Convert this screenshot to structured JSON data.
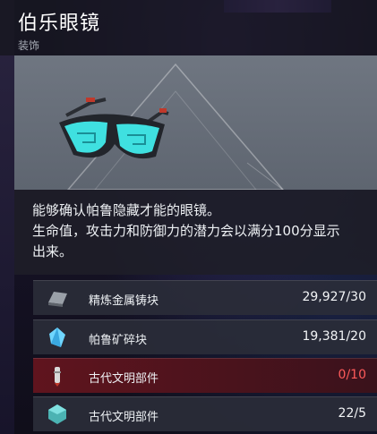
{
  "item": {
    "name": "伯乐眼镜",
    "category": "装饰"
  },
  "description": {
    "lines": [
      "能够确认帕鲁隐藏才能的眼镜。",
      "生命值，攻击力和防御力的潜力会以满分100分显示",
      "出来。"
    ]
  },
  "materials": [
    {
      "name": "精炼金属铸块",
      "count": "29,927/30",
      "icon": "metal-ingot-icon",
      "sufficient": true
    },
    {
      "name": "帕鲁矿碎块",
      "count": "19,381/20",
      "icon": "pal-crystal-icon",
      "sufficient": true
    },
    {
      "name": "古代文明部件",
      "count": "0/10",
      "icon": "ancient-part-icon",
      "sufficient": false
    },
    {
      "name": "古代文明部件",
      "count": "22/5",
      "icon": "ancient-core-icon",
      "sufficient": true
    }
  ],
  "colors": {
    "warn_row": "#64141e",
    "warn_text": "#ff5a5a",
    "lens": "#3fe0e0"
  }
}
